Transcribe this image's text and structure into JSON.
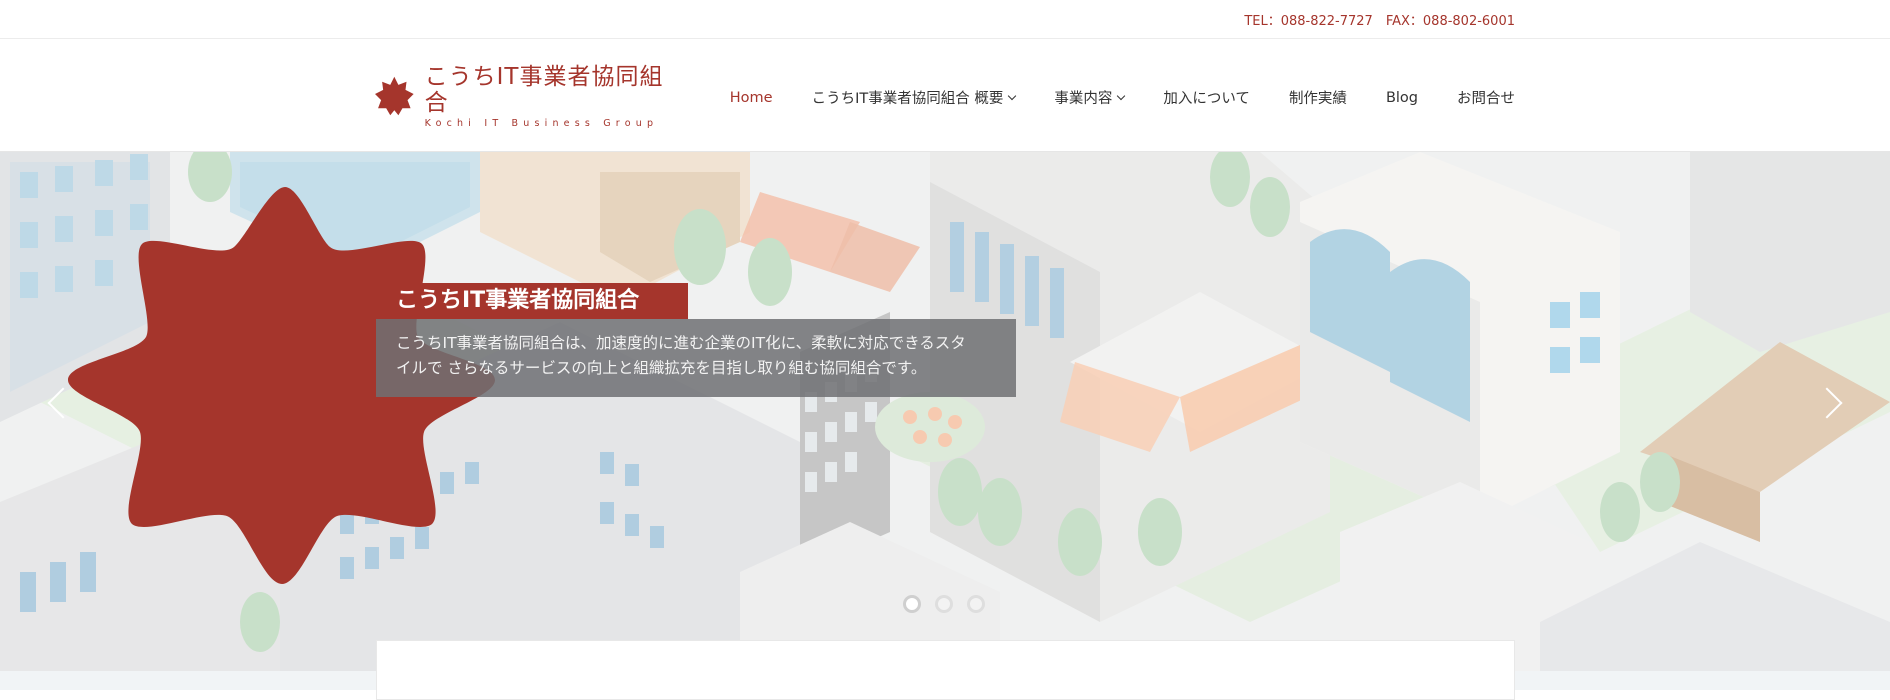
{
  "topbar": {
    "contact": "TEL：088-822-7727　FAX：088-802-6001"
  },
  "logo": {
    "title": "こうちIT事業者協同組合",
    "subtitle": "Kochi IT Business Group",
    "icon": "red-star-seal-icon"
  },
  "nav": {
    "items": [
      {
        "label": "Home",
        "active": true,
        "dropdown": false
      },
      {
        "label": "こうちIT事業者協同組合 概要",
        "active": false,
        "dropdown": true
      },
      {
        "label": "事業内容",
        "active": false,
        "dropdown": true
      },
      {
        "label": "加入について",
        "active": false,
        "dropdown": false
      },
      {
        "label": "制作実績",
        "active": false,
        "dropdown": false
      },
      {
        "label": "Blog",
        "active": false,
        "dropdown": false
      },
      {
        "label": "お問合せ",
        "active": false,
        "dropdown": false
      }
    ]
  },
  "hero": {
    "caption_title": "こうちIT事業者協同組合",
    "caption_body_line1": "こうちIT事業者協同組合は、加速度的に進む企業のIT化に、柔軟に対応できるスタ",
    "caption_body_line2": "イルで さらなるサービスの向上と組織拡充を目指し取り組む協同組合です。",
    "slides": 3,
    "active_slide": 1
  },
  "colors": {
    "brand": "#a5352c",
    "caption_bg": "#6e7073",
    "hero_bg": "#eef0ef"
  }
}
